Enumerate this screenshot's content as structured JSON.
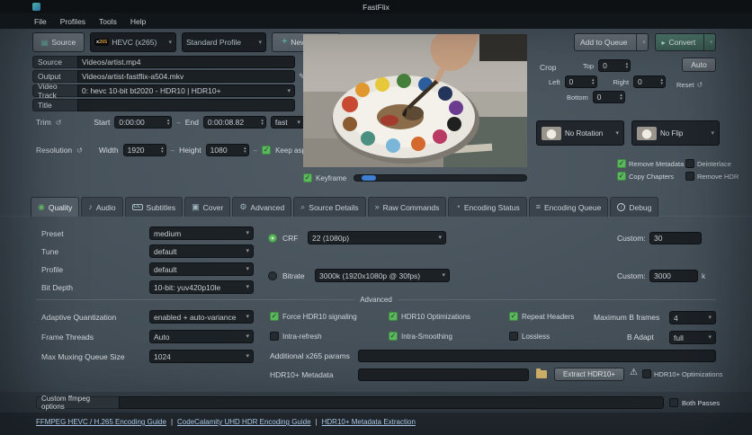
{
  "window": {
    "title": "FastFlix"
  },
  "menu": {
    "items": [
      {
        "label": "File"
      },
      {
        "label": "Profiles"
      },
      {
        "label": "Tools"
      },
      {
        "label": "Help"
      }
    ]
  },
  "toolbar": {
    "source_button": "Source",
    "codec_badge_x": "x",
    "codec_badge_num": "265",
    "codec_value": "HEVC (x265)",
    "profile_value": "Standard Profile",
    "new_profile_button": "New Profile",
    "add_to_queue_button": "Add to Queue",
    "convert_button": "Convert"
  },
  "form": {
    "source_label": "Source",
    "source_value": "Videos/artist.mp4",
    "output_label": "Output",
    "output_value": "Videos/artist-fastflix-a504.mkv",
    "video_track_label": "Video Track",
    "video_track_value": "0: hevc 10-bit bt2020 - HDR10 | HDR10+",
    "title_label": "Title",
    "title_value": "",
    "trim_label": "Trim",
    "trim_start_label": "Start",
    "trim_start_value": "0:00:00",
    "trim_end_label": "End",
    "trim_end_value": "0:00:08.82",
    "trim_speed_value": "fast",
    "resolution_label": "Resolution",
    "width_label": "Width",
    "width_value": "1920",
    "height_label": "Height",
    "height_value": "1080",
    "keep_aspect_label": "Keep aspect ratio"
  },
  "preview": {
    "keyframe_label": "Keyframe"
  },
  "transform": {
    "crop_label": "Crop",
    "top_label": "Top",
    "top_value": "0",
    "left_label": "Left",
    "left_value": "0",
    "right_label": "Right",
    "right_value": "0",
    "bottom_label": "Bottom",
    "bottom_value": "0",
    "auto_button": "Auto",
    "reset_button": "Reset",
    "rotation_value": "No Rotation",
    "flip_value": "No Flip",
    "remove_metadata_label": "Remove Metadata",
    "deinterlace_label": "Deinterlace",
    "copy_chapters_label": "Copy Chapters",
    "remove_hdr_label": "Remove HDR"
  },
  "tabs": [
    {
      "label": "Quality",
      "icon": "◉"
    },
    {
      "label": "Audio",
      "icon": "♪"
    },
    {
      "label": "Subtitles",
      "icon": "CC"
    },
    {
      "label": "Cover",
      "icon": "▣"
    },
    {
      "label": "Advanced",
      "icon": "⚙"
    },
    {
      "label": "Source Details",
      "icon": "⌕"
    },
    {
      "label": "Raw Commands",
      "icon": "»"
    },
    {
      "label": "Encoding Status",
      "icon": "◔"
    },
    {
      "label": "Encoding Queue",
      "icon": "≡"
    },
    {
      "label": "Debug",
      "icon": "i"
    }
  ],
  "quality": {
    "preset_label": "Preset",
    "preset_value": "medium",
    "tune_label": "Tune",
    "tune_value": "default",
    "profile_label": "Profile",
    "profile_value": "default",
    "bit_depth_label": "Bit Depth",
    "bit_depth_value": "10-bit: yuv420p10le",
    "crf_label": "CRF",
    "crf_value": "22   (1080p)",
    "crf_custom_label": "Custom:",
    "crf_custom_value": "30",
    "bitrate_label": "Bitrate",
    "bitrate_value": "3000k   (1920x1080p @ 30fps)",
    "bitrate_custom_label": "Custom:",
    "bitrate_custom_value": "3000",
    "bitrate_custom_suffix": "k",
    "advanced_label": "Advanced",
    "aq_label": "Adaptive Quantization",
    "aq_value": "enabled + auto-variance",
    "force_hdr10_label": "Force HDR10 signaling",
    "hdr10_opt_label": "HDR10 Optimizations",
    "repeat_headers_label": "Repeat Headers",
    "max_b_frames_label": "Maximum B frames",
    "max_b_frames_value": "4",
    "frame_threads_label": "Frame Threads",
    "frame_threads_value": "Auto",
    "intra_refresh_label": "Intra-refresh",
    "intra_smoothing_label": "Intra-Smoothing",
    "lossless_label": "Lossless",
    "b_adapt_label": "B Adapt",
    "b_adapt_value": "full",
    "max_muxing_label": "Max Muxing Queue Size",
    "max_muxing_value": "1024",
    "x265_params_label": "Additional x265 params",
    "hdr10plus_label": "HDR10+ Metadata",
    "extract_button": "Extract HDR10+",
    "hdr10plus_opt_label": "HDR10+ Optimizations"
  },
  "footer": {
    "custom_ffmpeg_label": "Custom ffmpeg options",
    "both_passes_label": "Both Passes",
    "separator": "|",
    "links": [
      {
        "label": "FFMPEG HEVC / H.265 Encoding Guide"
      },
      {
        "label": "CodeCalamity UHD HDR Encoding Guide"
      },
      {
        "label": "HDR10+ Metadata Extraction"
      }
    ]
  },
  "colors": {
    "accent_green": "#5cb75f",
    "convert_teal": "#46705f",
    "link_blue": "#aac6e4",
    "slider_blue": "#3f7fd4"
  }
}
